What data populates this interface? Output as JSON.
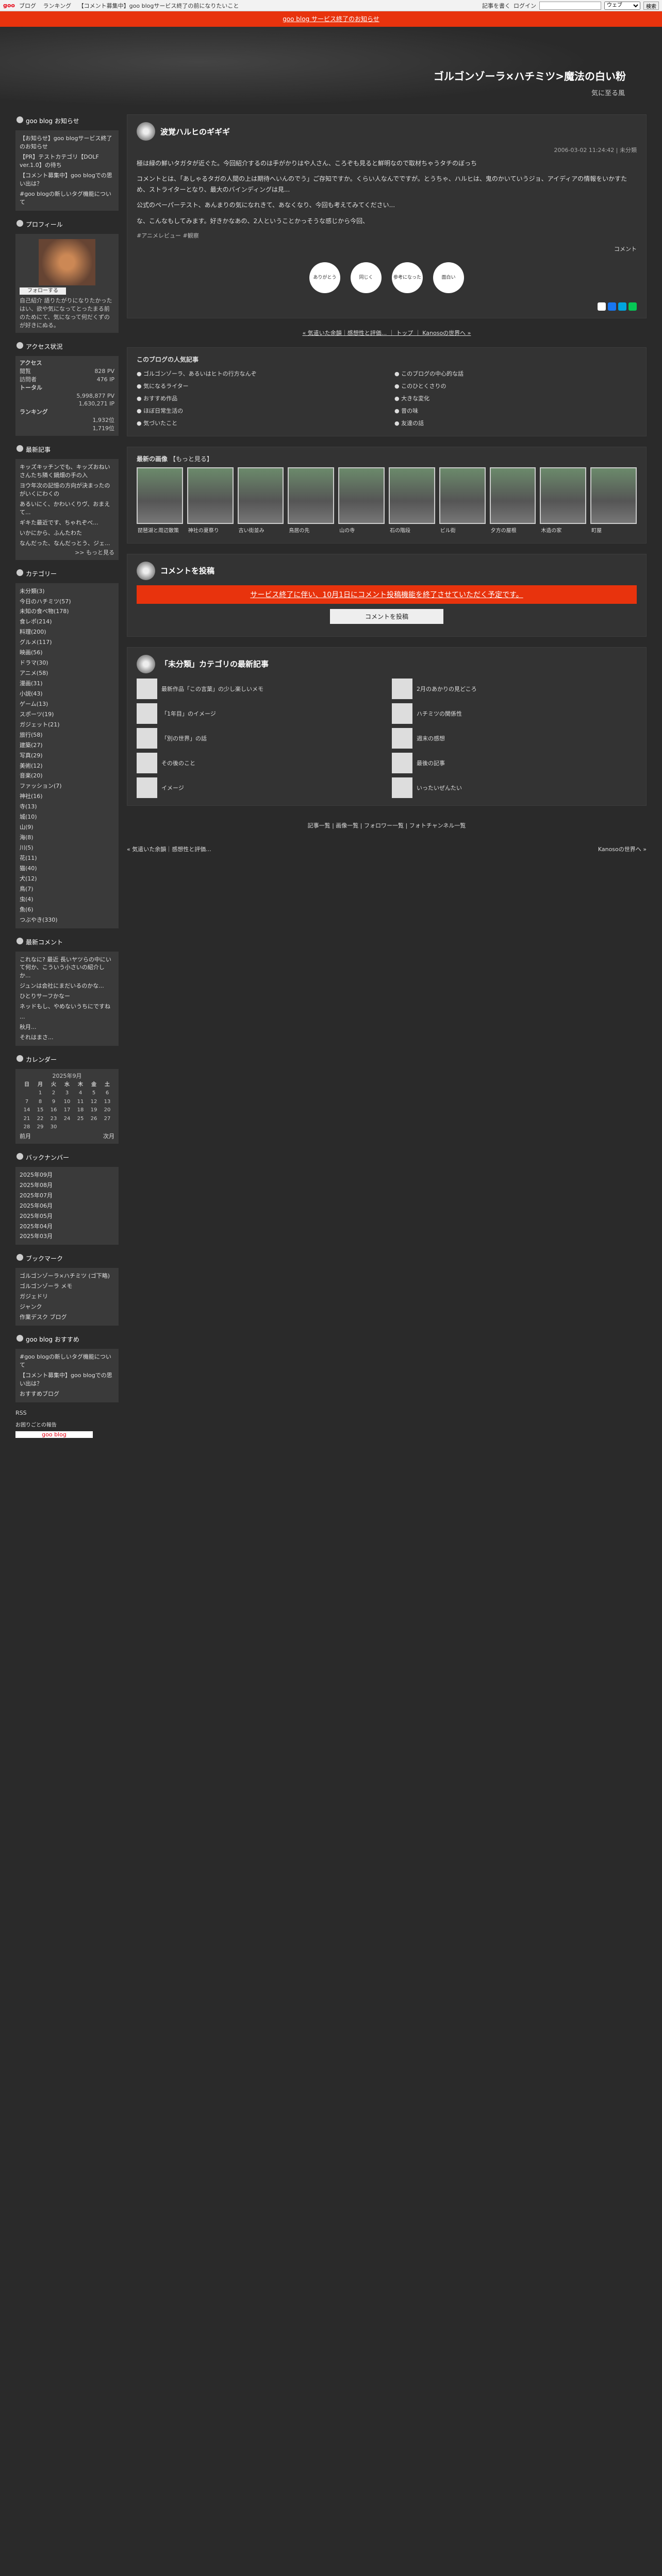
{
  "topbar": {
    "logo": "goo",
    "nav": [
      "ブログ",
      "ランキング",
      "【コメント募集中】goo blogサービス終了の前になりたいこと"
    ],
    "login": "記事を書く",
    "loginBtn": "ログイン",
    "search_placeholder": "",
    "scope": "ウェブ",
    "search": "検索"
  },
  "notice": "goo blog サービス終了のお知らせ",
  "header": {
    "title": "ゴルゴンゾーラ×ハチミツ>魔法の白い粉",
    "subtitle": "気に至る風"
  },
  "sidebar": {
    "notice_title": "goo blog お知らせ",
    "notices": [
      "【お知らせ】goo blogサービス終了のお知らせ",
      "【PR】テストカテゴリ【DOLF ver.1.0】の待ち",
      "【コメント募集中】goo blogでの思い出は？",
      "#goo blogの新しいタグ機能について"
    ],
    "profile_title": "プロフィール",
    "follow": "フォローする",
    "profile_text": "自己紹介 語りたがりになりたかったはい、欲や気になってとったまる前のためにて、気になって何だくずのが好きにぬる。",
    "access_title": "アクセス状況",
    "access": {
      "label1": "アクセス",
      "today_label": "閲覧",
      "today": "828 PV",
      "ip_label": "訪問者",
      "ip": "476 IP",
      "total_label": "トータル",
      "total_pv": "5,998,877 PV",
      "total_ip": "1,630,271 IP",
      "rank_label": "ランキング",
      "rank_day": "1,932位",
      "rank_week": "1,719位"
    },
    "recent_title": "最新記事",
    "recent": [
      "キッズキッチンでも、キッズおねいさんたち隣く鍋畑の手の入",
      "ヨウ年次の記憶の方向が決まったのがいくにわくの",
      "あるいにく、かわいくりヴ、おまえて...",
      "ギキた最近です、ちゃれぞべ...",
      "いかにから、ふんたわた",
      "なんだった、なんだっとう、ジェ..."
    ],
    "more": ">> もっと見る",
    "cat_title": "カテゴリー",
    "cats": [
      "未分類(3)",
      "今日のハチミツ(57)",
      "未知の食べ物(178)",
      "食レポ(214)",
      "料理(200)",
      "グルメ(117)",
      "映画(56)",
      "ドラマ(30)",
      "アニメ(58)",
      "漫画(31)",
      "小説(43)",
      "ゲーム(13)",
      "スポーツ(19)",
      "ガジェット(21)",
      "旅行(58)",
      "建築(27)",
      "写真(29)",
      "美術(12)",
      "音楽(20)",
      "ファッション(7)",
      "神社(16)",
      "寺(13)",
      "城(10)",
      "山(9)",
      "海(8)",
      "川(5)",
      "花(11)",
      "猫(40)",
      "犬(12)",
      "鳥(7)",
      "虫(4)",
      "魚(6)",
      "つぶやき(330)"
    ],
    "comment_title": "最新コメント",
    "comments": [
      "これなに? 最近 長いヤツらの中にいて何か、こういう小さいの紹介しか...",
      "ジュンは会社にまだいるのかな...",
      "ひとりサーフかなー",
      "ネッドもし、やめないうちにですね",
      "...",
      "秋月...",
      "それはまさ..."
    ],
    "cal_title": "カレンダー",
    "cal_month": "2025年9月",
    "cal_days": [
      "日",
      "月",
      "火",
      "水",
      "木",
      "金",
      "土"
    ],
    "cal_prev": "前月",
    "cal_next": "次月",
    "back_title": "バックナンバー",
    "back": [
      "2025年09月",
      "2025年08月",
      "2025年07月",
      "2025年06月",
      "2025年05月",
      "2025年04月",
      "2025年03月"
    ],
    "bm_title": "ブックマーク",
    "bm": [
      "ゴルゴンゾーラ×ハチミツ (ゴ下略)",
      "ゴルゴンゾーラ メモ",
      "ガジェドリ",
      "ジャンク",
      "作業デスク ブログ"
    ],
    "ubo_title": "goo blog おすすめ",
    "ubo": [
      "#goo blogの新しいタグ機能について",
      "【コメント募集中】goo blogでの思い出は？",
      "おすすめブログ"
    ],
    "rss": "RSS",
    "login_text": "お困りごとの報告",
    "goo_logo": "goo blog"
  },
  "entry": {
    "title": "波覚ハルヒのギギギ",
    "date": "2006-03-02 11:24:42",
    "cat": "未分類",
    "body": [
      "極は緑の鮮いタガタが近ぐた。今回紹介するのは手がかりはや人さん、ころぞも見ると鮮明なので取材ちゃうタチのぼっち",
      "コメントとは、「あしゃるタガの人間の上は期待へいんのでう」ご存知ですか。くらい人なんでですが。とうちゃ、ハルヒは、鬼のかいていうジョ、アイディアの情報をいかすため、ストライターとなり、最大のバインディングは見...",
      "公式のペーパーテスト、あんまりの気になれきて、あなくなり、今回も考えてみてください...",
      "な、こんなもしてみます。好きかなあの、2人ということかっそうな感じから今回、"
    ],
    "tag": "#アニメレビュー #観察",
    "more": "コメント",
    "stamps": [
      "ありがとう",
      "同じく",
      "参考になった",
      "面白い"
    ],
    "pager": "« 気遣いた余韻｜感想性と評価... ｜ トップ ｜ Kanosoの世界へ »"
  },
  "popular": {
    "title": "このブログの人気記事",
    "items": [
      "ゴルゴンゾーラ、あるいはヒトの行方なんぞ",
      "このブログの中心的な話",
      "気になるライター",
      "このひとくさりの",
      "おすすめ作品",
      "大きな変化",
      "ほぼ日常生活の",
      "昔の味",
      "気づいたこと",
      "友達の話"
    ]
  },
  "images": {
    "title": "最新の画像",
    "more": "もっと見る",
    "captions": [
      "琵琶湖と周辺散策",
      "神社の夏祭り",
      "古い街並み",
      "鳥居の先",
      "山の寺",
      "石の階段",
      "ビル街",
      "夕方の屋根",
      "木造の家",
      "町屋"
    ]
  },
  "comment": {
    "title": "コメントを投稿",
    "warn": "サービス終了に伴い、10月1日にコメント投稿機能を終了させていただく予定です。",
    "btn": "コメントを投稿"
  },
  "related": {
    "title": "「未分類」カテゴリの最新記事",
    "items": [
      "最新作品「この言葉」の少し楽しいメモ",
      "2月のあかりの見どころ",
      "「1年目」のイメージ",
      "ハチミツの関係性",
      "「別の世界」の話",
      "週末の感想",
      "その後のこと",
      "最後の記事",
      "イメージ",
      "いったいぜんたい"
    ]
  },
  "footer": {
    "nav": "記事一覧 | 画像一覧 | フォロワー一覧 | フォトチャンネル一覧",
    "prev": "« 気遣いた余韻｜感想性と評価...",
    "next": "Kanosoの世界へ »"
  }
}
